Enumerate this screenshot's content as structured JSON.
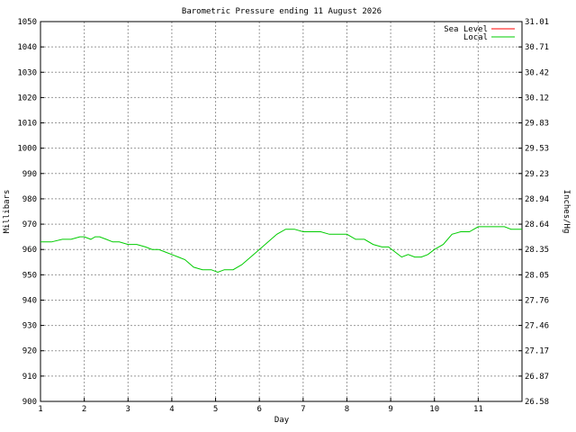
{
  "chart_data": {
    "type": "line",
    "title": "Barometric Pressure ending 11 August 2026",
    "xlabel": "Day",
    "ylabel": "Millibars",
    "ylabel_right": "Inches/Hg",
    "xlim": [
      1,
      12
    ],
    "ylim": [
      900,
      1050
    ],
    "x_ticks": [
      "1",
      "2",
      "3",
      "4",
      "5",
      "6",
      "7",
      "8",
      "9",
      "10",
      "11"
    ],
    "y_ticks": [
      "900",
      "910",
      "920",
      "930",
      "940",
      "950",
      "960",
      "970",
      "980",
      "990",
      "1000",
      "1010",
      "1020",
      "1030",
      "1040",
      "1050"
    ],
    "y_ticks_right": [
      "26.58",
      "26.87",
      "27.17",
      "27.46",
      "27.76",
      "28.05",
      "28.35",
      "28.64",
      "28.94",
      "29.23",
      "29.53",
      "29.83",
      "30.12",
      "30.42",
      "30.71",
      "31.01"
    ],
    "grid": true,
    "legend_position": "top-right",
    "series": [
      {
        "name": "Sea Level",
        "color": "#ff0000",
        "x": [],
        "values": []
      },
      {
        "name": "Local",
        "color": "#00cc00",
        "x": [
          1.0,
          1.25,
          1.5,
          1.7,
          1.9,
          2.0,
          2.15,
          2.25,
          2.35,
          2.5,
          2.65,
          2.8,
          3.0,
          3.2,
          3.4,
          3.55,
          3.7,
          3.85,
          4.0,
          4.15,
          4.3,
          4.5,
          4.7,
          4.9,
          5.05,
          5.2,
          5.4,
          5.6,
          5.8,
          6.0,
          6.2,
          6.4,
          6.6,
          6.8,
          7.0,
          7.2,
          7.4,
          7.6,
          7.8,
          8.0,
          8.2,
          8.4,
          8.6,
          8.8,
          8.95,
          9.1,
          9.25,
          9.4,
          9.55,
          9.7,
          9.85,
          10.0,
          10.2,
          10.4,
          10.6,
          10.8,
          10.9,
          11.0,
          11.3,
          11.6,
          11.75,
          12.0
        ],
        "values": [
          963,
          963,
          964,
          964,
          965,
          965,
          964,
          965,
          965,
          964,
          963,
          963,
          962,
          962,
          961,
          960,
          960,
          959,
          958,
          957,
          956,
          953,
          952,
          952,
          951,
          952,
          952,
          954,
          957,
          960,
          963,
          966,
          968,
          968,
          967,
          967,
          967,
          966,
          966,
          966,
          964,
          964,
          962,
          961,
          961,
          959,
          957,
          958,
          957,
          957,
          958,
          960,
          962,
          966,
          967,
          967,
          968,
          969,
          969,
          969,
          968,
          968
        ]
      }
    ]
  }
}
